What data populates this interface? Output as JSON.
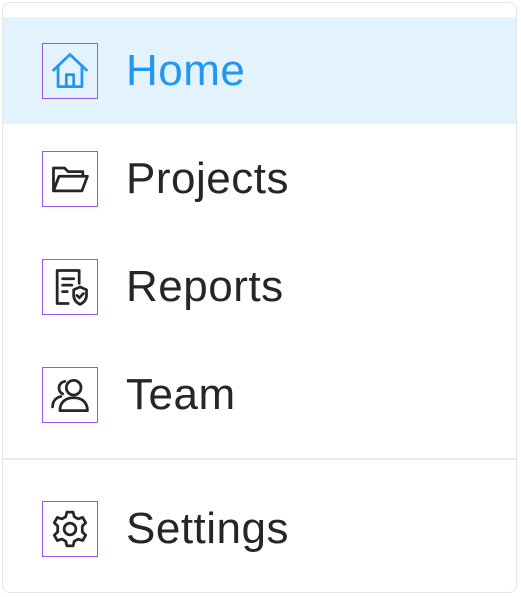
{
  "menu": {
    "items": [
      {
        "label": "Home",
        "icon": "home-icon",
        "active": true
      },
      {
        "label": "Projects",
        "icon": "folder-open-icon",
        "active": false
      },
      {
        "label": "Reports",
        "icon": "report-shield-icon",
        "active": false
      },
      {
        "label": "Team",
        "icon": "team-icon",
        "active": false
      }
    ],
    "footer_items": [
      {
        "label": "Settings",
        "icon": "gear-icon",
        "active": false
      }
    ]
  },
  "colors": {
    "active_background": "#e3f3fd",
    "active_text": "#2196f3",
    "text": "#262626",
    "icon_outline_highlight": "#9b55f0"
  }
}
